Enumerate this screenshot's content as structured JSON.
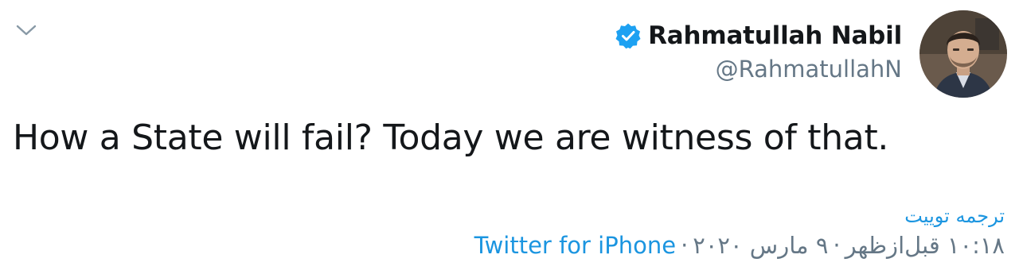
{
  "author": {
    "display_name": "Rahmatullah Nabil",
    "handle": "@RahmatullahN",
    "verified": true
  },
  "tweet": {
    "text": "How a State will fail? Today we are witness of that.",
    "translate_label": "ترجمه توییت",
    "time": "۱۰:۱۸ قبل‌ازظهر",
    "separator": "·",
    "date": "۹ مارس ۲۰۲۰",
    "source": "Twitter for iPhone"
  },
  "colors": {
    "link": "#1b95e0",
    "verified_badge": "#1da1f2",
    "secondary_text": "#657786",
    "primary_text": "#14171a"
  },
  "icons": [
    "chevron-down-icon",
    "verified-badge-icon"
  ]
}
